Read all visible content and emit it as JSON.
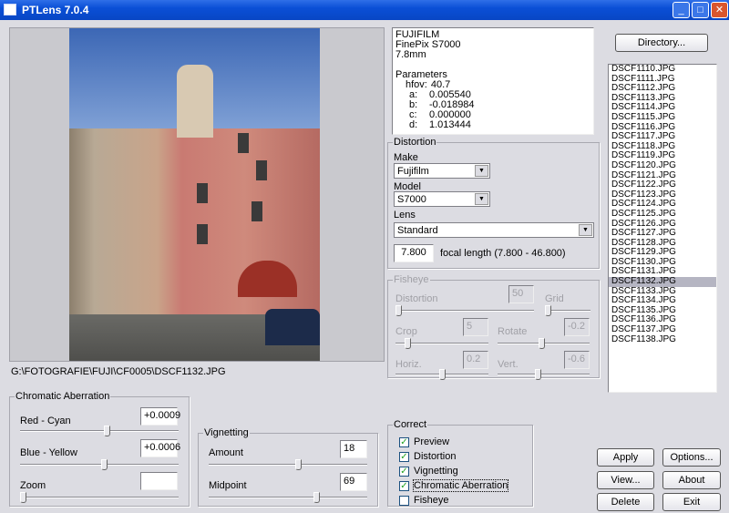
{
  "window": {
    "title": "PTLens 7.0.4",
    "minimize": "_",
    "maximize": "□",
    "close": "✕"
  },
  "image": {
    "path": "G:\\FOTOGRAFIE\\FUJI\\CF0005\\DSCF1132.JPG"
  },
  "info": {
    "make": "FUJIFILM",
    "model": "FinePix S7000",
    "focal": "7.8mm",
    "params_label": "Parameters",
    "params": [
      {
        "k": "hfov:",
        "v": "40.7"
      },
      {
        "k": "a:",
        "v": "0.005540"
      },
      {
        "k": "b:",
        "v": "-0.018984"
      },
      {
        "k": "c:",
        "v": "0.000000"
      },
      {
        "k": "d:",
        "v": "1.013444"
      }
    ]
  },
  "distortion": {
    "title": "Distortion",
    "make_label": "Make",
    "make": "Fujifilm",
    "model_label": "Model",
    "model": "S7000",
    "lens_label": "Lens",
    "lens": "Standard",
    "focal_value": "7.800",
    "focal_label": "focal length (7.800 - 46.800)"
  },
  "fisheye": {
    "title": "Fisheye",
    "distortion_label": "Distortion",
    "distortion": "50",
    "distortion_level": 0,
    "grid_label": "Grid",
    "grid_level": 0,
    "crop_label": "Crop",
    "crop": "5",
    "crop_level": 0.1,
    "rotate_label": "Rotate",
    "rotate": "-0.2",
    "rotate_level": 0.48,
    "horiz_label": "Horiz.",
    "horiz": "0.2",
    "horiz_level": 0.5,
    "vert_label": "Vert.",
    "vert": "-0.6",
    "vert_level": 0.44
  },
  "chromatic": {
    "title": "Chromatic Aberration",
    "red_label": "Red - Cyan",
    "red": "+0.0009",
    "red_level": 0.55,
    "blue_label": "Blue - Yellow",
    "blue": "+0.0006",
    "blue_level": 0.53,
    "zoom_label": "Zoom",
    "zoom": "",
    "zoom_level": 0
  },
  "vignetting": {
    "title": "Vignetting",
    "amount_label": "Amount",
    "amount": "18",
    "amount_level": 0.57,
    "midpoint_label": "Midpoint",
    "midpoint": "69",
    "midpoint_level": 0.69
  },
  "correct": {
    "title": "Correct",
    "items": [
      {
        "label": "Preview",
        "checked": true
      },
      {
        "label": "Distortion",
        "checked": true
      },
      {
        "label": "Vignetting",
        "checked": true
      },
      {
        "label": "Chromatic Aberration",
        "checked": true
      },
      {
        "label": "Fisheye",
        "checked": false
      }
    ]
  },
  "buttons": {
    "directory": "Directory...",
    "apply": "Apply",
    "options": "Options...",
    "view": "View...",
    "about": "About",
    "delete": "Delete",
    "exit": "Exit"
  },
  "files": {
    "selected": "DSCF1132.JPG",
    "items": [
      "DSCF1110.JPG",
      "DSCF1111.JPG",
      "DSCF1112.JPG",
      "DSCF1113.JPG",
      "DSCF1114.JPG",
      "DSCF1115.JPG",
      "DSCF1116.JPG",
      "DSCF1117.JPG",
      "DSCF1118.JPG",
      "DSCF1119.JPG",
      "DSCF1120.JPG",
      "DSCF1121.JPG",
      "DSCF1122.JPG",
      "DSCF1123.JPG",
      "DSCF1124.JPG",
      "DSCF1125.JPG",
      "DSCF1126.JPG",
      "DSCF1127.JPG",
      "DSCF1128.JPG",
      "DSCF1129.JPG",
      "DSCF1130.JPG",
      "DSCF1131.JPG",
      "DSCF1132.JPG",
      "DSCF1133.JPG",
      "DSCF1134.JPG",
      "DSCF1135.JPG",
      "DSCF1136.JPG",
      "DSCF1137.JPG",
      "DSCF1138.JPG"
    ]
  }
}
